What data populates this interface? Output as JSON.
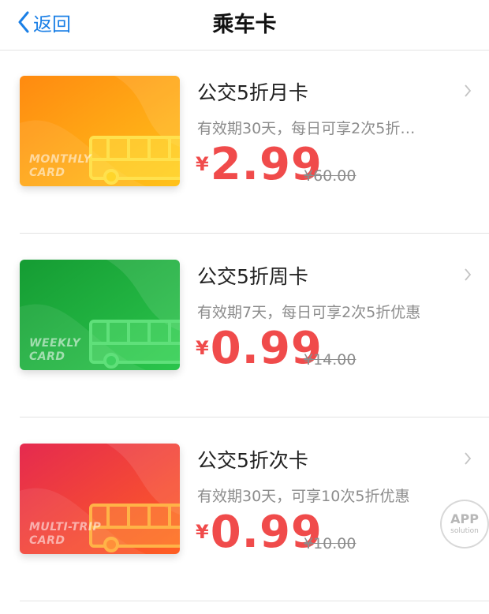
{
  "nav": {
    "back_label": "返回",
    "title": "乘车卡"
  },
  "cards": [
    {
      "name": "公交5折月卡",
      "description": "有效期30天，每日可享2次5折…",
      "currency": "¥",
      "price": "2.99",
      "original_price": "¥60.00",
      "card_text": [
        "MONTHLY",
        "CARD"
      ],
      "colors": {
        "from": "#ff9a1f",
        "to": "#ffb020",
        "accent": "#ffe14d"
      }
    },
    {
      "name": "公交5折周卡",
      "description": "有效期7天，每日可享2次5折优惠",
      "currency": "¥",
      "price": "0.99",
      "original_price": "¥14.00",
      "card_text": [
        "WEEKLY",
        "CARD"
      ],
      "colors": {
        "from": "#1aa93a",
        "to": "#27c24a",
        "accent": "#5fe07a"
      }
    },
    {
      "name": "公交5折次卡",
      "description": "有效期30天，可享10次5折优惠",
      "currency": "¥",
      "price": "0.99",
      "original_price": "¥10.00",
      "card_text": [
        "MULTI-TRIP",
        "CARD"
      ],
      "colors": {
        "from": "#e8314c",
        "to": "#ff5a2a",
        "accent": "#ffb347"
      }
    }
  ],
  "watermark": {
    "line1": "APP",
    "line2": "solution"
  }
}
